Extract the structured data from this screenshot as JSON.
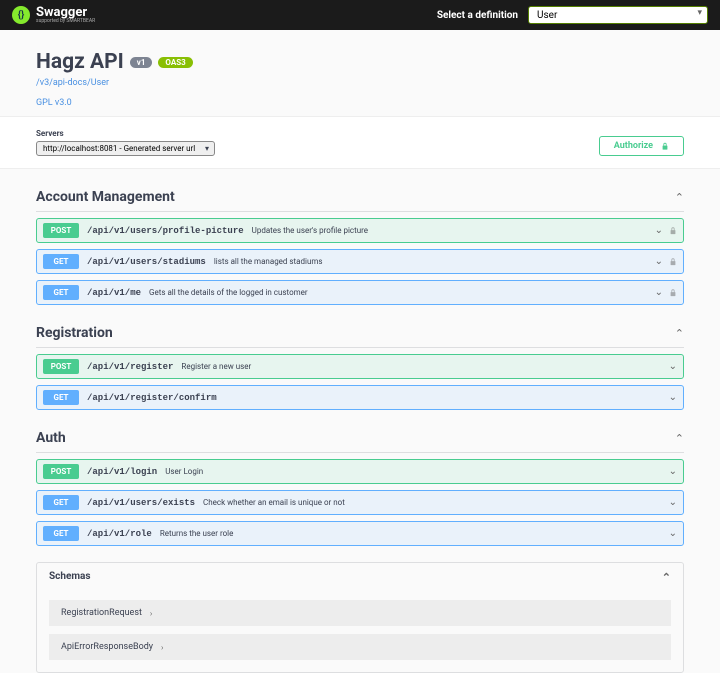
{
  "header": {
    "brand": "Swagger",
    "brand_sub": "supported by SMARTBEAR",
    "def_label": "Select a definition",
    "def_selected": "User"
  },
  "info": {
    "title": "Hagz API",
    "version": "v1",
    "oas": "OAS3",
    "docs_link": "/v3/api-docs/User",
    "license": "GPL v3.0"
  },
  "servers": {
    "label": "Servers",
    "selected": "http://localhost:8081 - Generated server url",
    "authorize": "Authorize"
  },
  "tags": [
    {
      "name": "Account Management",
      "ops": [
        {
          "method": "POST",
          "path": "/api/v1/users/profile-picture",
          "summary": "Updates the user's profile picture",
          "lock": true
        },
        {
          "method": "GET",
          "path": "/api/v1/users/stadiums",
          "summary": "lists all the managed stadiums",
          "lock": true
        },
        {
          "method": "GET",
          "path": "/api/v1/me",
          "summary": "Gets all the details of the logged in customer",
          "lock": true
        }
      ]
    },
    {
      "name": "Registration",
      "ops": [
        {
          "method": "POST",
          "path": "/api/v1/register",
          "summary": "Register a new user",
          "lock": false
        },
        {
          "method": "GET",
          "path": "/api/v1/register/confirm",
          "summary": "",
          "lock": false
        }
      ]
    },
    {
      "name": "Auth",
      "ops": [
        {
          "method": "POST",
          "path": "/api/v1/login",
          "summary": "User Login",
          "lock": false
        },
        {
          "method": "GET",
          "path": "/api/v1/users/exists",
          "summary": "Check whether an email is unique or not",
          "lock": false
        },
        {
          "method": "GET",
          "path": "/api/v1/role",
          "summary": "Returns the user role",
          "lock": false
        }
      ]
    }
  ],
  "schemas": {
    "title": "Schemas",
    "models": [
      "RegistrationRequest",
      "ApiErrorResponseBody"
    ]
  }
}
